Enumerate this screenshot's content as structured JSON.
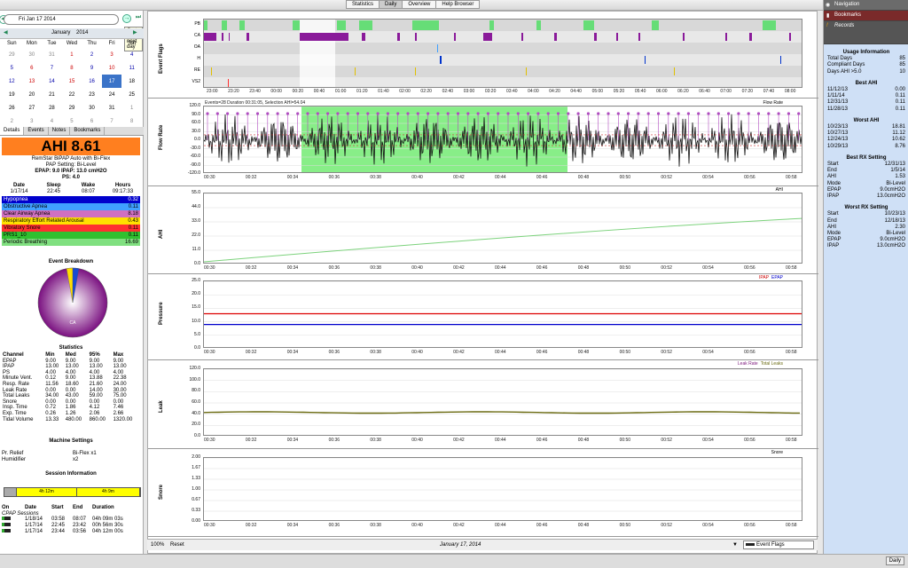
{
  "top_tabs": [
    "Statistics",
    "Daily",
    "Overview",
    "Help Browser"
  ],
  "active_tab": "Daily",
  "date_value": "Fri Jan 17 2014",
  "tooltip": "Go to the next day",
  "month": "January",
  "year": "2014",
  "weekdays": [
    "Sun",
    "Mon",
    "Tue",
    "Wed",
    "Thu",
    "Fri",
    "Sat"
  ],
  "cal_weeks": [
    [
      "29",
      "30",
      "31",
      "1",
      "2",
      "3",
      "4"
    ],
    [
      "5",
      "6",
      "7",
      "8",
      "9",
      "10",
      "11"
    ],
    [
      "12",
      "13",
      "14",
      "15",
      "16",
      "17",
      "18"
    ],
    [
      "19",
      "20",
      "21",
      "22",
      "23",
      "24",
      "25"
    ],
    [
      "26",
      "27",
      "28",
      "29",
      "30",
      "31",
      "1"
    ],
    [
      "2",
      "3",
      "4",
      "5",
      "6",
      "7",
      "8"
    ]
  ],
  "sub_tabs": [
    "Details",
    "Events",
    "Notes",
    "Bookmarks"
  ],
  "ahi_text": "AHI 8.61",
  "machine_name": "RemStar BiPAP Auto with Bi-Flex",
  "pap_setting": "PAP Setting: Bi-Level",
  "pressure_setting": "EPAP: 9.0 IPAP: 13.0 cmH2O",
  "ps_setting": "PS: 4.0",
  "dsw_headers": [
    "Date",
    "Sleep",
    "Wake",
    "Hours"
  ],
  "dsw_values": [
    "1/17/14",
    "22:45",
    "08:07",
    "09:17:33"
  ],
  "events": [
    {
      "name": "Hypopnea",
      "value": "0.32",
      "color": "#0000cc",
      "text": "#fff"
    },
    {
      "name": "Obstructive Apnea",
      "value": "0.11",
      "color": "#40a0ff",
      "text": "#000"
    },
    {
      "name": "Clear Airway Apnea",
      "value": "8.18",
      "color": "#d070c0",
      "text": "#000"
    },
    {
      "name": "Respiratory Effort Related Arousal",
      "value": "0.43",
      "color": "#ffe000",
      "text": "#000"
    },
    {
      "name": "Vibratory Snore",
      "value": "0.11",
      "color": "#ff3030",
      "text": "#000"
    },
    {
      "name": "PRS1_10",
      "value": "0.11",
      "color": "#30c030",
      "text": "#000"
    },
    {
      "name": "Periodic Breathing",
      "value": "16.69",
      "color": "#80e080",
      "text": "#000"
    }
  ],
  "event_breakdown_title": "Event Breakdown",
  "pie_label": "CA",
  "statistics_title": "Statistics",
  "stats_headers": [
    "Channel",
    "Min",
    "Med",
    "95%",
    "Max"
  ],
  "stats_rows": [
    [
      "EPAP",
      "9.00",
      "9.00",
      "9.00",
      "9.00"
    ],
    [
      "IPAP",
      "13.00",
      "13.00",
      "13.00",
      "13.00"
    ],
    [
      "PS",
      "4.00",
      "4.00",
      "4.00",
      "4.00"
    ],
    [
      "Minute Vent.",
      "0.12",
      "9.00",
      "13.88",
      "22.38"
    ],
    [
      "Resp. Rate",
      "11.56",
      "18.60",
      "21.60",
      "24.00"
    ],
    [
      "Leak Rate",
      "0.00",
      "0.00",
      "14.00",
      "30.00"
    ],
    [
      "Total Leaks",
      "34.00",
      "43.00",
      "59.00",
      "75.00"
    ],
    [
      "Snore",
      "0.00",
      "0.00",
      "0.00",
      "0.00"
    ],
    [
      "Insp. Time",
      "0.72",
      "1.86",
      "4.12",
      "7.46"
    ],
    [
      "Exp. Time",
      "0.26",
      "1.26",
      "2.06",
      "2.66"
    ],
    [
      "Tidal Volume",
      "13.33",
      "480.00",
      "860.00",
      "1320.00"
    ]
  ],
  "machine_settings_title": "Machine Settings",
  "machine_settings": [
    [
      "Pr. Relief",
      "Bi-Flex x1"
    ],
    [
      "Humidifier",
      "x2"
    ]
  ],
  "session_info_title": "Session Information",
  "session_bar": [
    "4h 12m",
    "4h 9m"
  ],
  "session_headers": [
    "On",
    "Date",
    "Start",
    "End",
    "Duration"
  ],
  "cpap_sessions_label": "CPAP Sessions",
  "sessions": [
    [
      "1/18/14",
      "03:58",
      "08:07",
      "04h 09m 03s"
    ],
    [
      "1/17/14",
      "22:45",
      "23:42",
      "00h 56m 30s"
    ],
    [
      "1/17/14",
      "23:44",
      "03:56",
      "04h 12m 00s"
    ]
  ],
  "flag_rows": [
    "PB",
    "CA",
    "OA",
    "H",
    "RE",
    "VS2"
  ],
  "flags_label": "Event Flags",
  "flag_times": [
    "23:00",
    "23:20",
    "23:40",
    "00:00",
    "00:20",
    "00:40",
    "01:00",
    "01:20",
    "01:40",
    "02:00",
    "02:20",
    "02:40",
    "03:00",
    "03:20",
    "03:40",
    "04:00",
    "04:20",
    "04:40",
    "05:00",
    "05:20",
    "05:40",
    "06:00",
    "06:20",
    "06:40",
    "07:00",
    "07:20",
    "07:40",
    "08:00"
  ],
  "detail_times": [
    "00:30",
    "00:32",
    "00:34",
    "00:36",
    "00:38",
    "00:40",
    "00:42",
    "00:44",
    "00:46",
    "00:48",
    "00:50",
    "00:52",
    "00:54",
    "00:56",
    "00:58"
  ],
  "flow_header": "Events=28 Duration 00:31:05, Selection AHI=54.04",
  "graphs": {
    "flow": {
      "label": "Flow Rate",
      "legend": "Flow Rate",
      "ticks": [
        "120.0",
        "90.0",
        "60.0",
        "30.0",
        "0.0",
        "-30.0",
        "-60.0",
        "-90.0",
        "-120.0"
      ]
    },
    "ahi": {
      "label": "AHI",
      "legend": "AHI",
      "ticks": [
        "55.0",
        "44.0",
        "33.0",
        "22.0",
        "11.0",
        "0.0"
      ]
    },
    "pressure": {
      "label": "Pressure",
      "legend1": "IPAP",
      "legend2": "EPAP",
      "ticks": [
        "25.0",
        "20.0",
        "15.0",
        "10.0",
        "5.0",
        "0.0"
      ]
    },
    "leak": {
      "label": "Leak",
      "legend1": "Leak Rate",
      "legend2": "Total Leaks",
      "ticks": [
        "120.0",
        "100.0",
        "80.0",
        "60.0",
        "40.0",
        "20.0",
        "0.0"
      ]
    },
    "snore": {
      "label": "Snore",
      "legend": "Snore",
      "ticks": [
        "2.00",
        "1.67",
        "1.33",
        "1.00",
        "0.67",
        "0.33",
        "0.00"
      ]
    }
  },
  "bottom": {
    "zoom": "100%",
    "reset": "Reset",
    "date": "January 17, 2014",
    "graph_select": "Event Flags"
  },
  "right": {
    "navigation": "Navigation",
    "bookmarks": "Bookmarks",
    "records": "Records",
    "usage_title": "Usage Information",
    "usage": [
      [
        "Total Days",
        "85"
      ],
      [
        "Compliant Days",
        "85"
      ],
      [
        "Days AHI >5.0",
        "10"
      ]
    ],
    "best_ahi_title": "Best AHI",
    "best_ahi": [
      [
        "11/12/13",
        "0.00"
      ],
      [
        "1/11/14",
        "0.11"
      ],
      [
        "12/31/13",
        "0.11"
      ],
      [
        "11/28/13",
        "0.11"
      ]
    ],
    "worst_ahi_title": "Worst AHI",
    "worst_ahi": [
      [
        "10/23/13",
        "18.81"
      ],
      [
        "10/27/13",
        "11.12"
      ],
      [
        "12/24/13",
        "10.62"
      ],
      [
        "10/29/13",
        "8.76"
      ]
    ],
    "best_rx_title": "Best RX Setting",
    "best_rx": [
      [
        "Start",
        "12/31/13"
      ],
      [
        "End",
        "1/5/14"
      ],
      [
        "AHI",
        "1.53"
      ],
      [
        "Mode",
        "Bi-Level"
      ],
      [
        "EPAP",
        "9.0cmH2O"
      ],
      [
        "IPAP",
        "13.0cmH2O"
      ]
    ],
    "worst_rx_title": "Worst RX Setting",
    "worst_rx": [
      [
        "Start",
        "10/23/13"
      ],
      [
        "End",
        "12/18/13"
      ],
      [
        "AHI",
        "2.30"
      ],
      [
        "Mode",
        "Bi-Level"
      ],
      [
        "EPAP",
        "9.0cmH2O"
      ],
      [
        "IPAP",
        "13.0cmH2O"
      ]
    ]
  },
  "status_button": "Daily"
}
